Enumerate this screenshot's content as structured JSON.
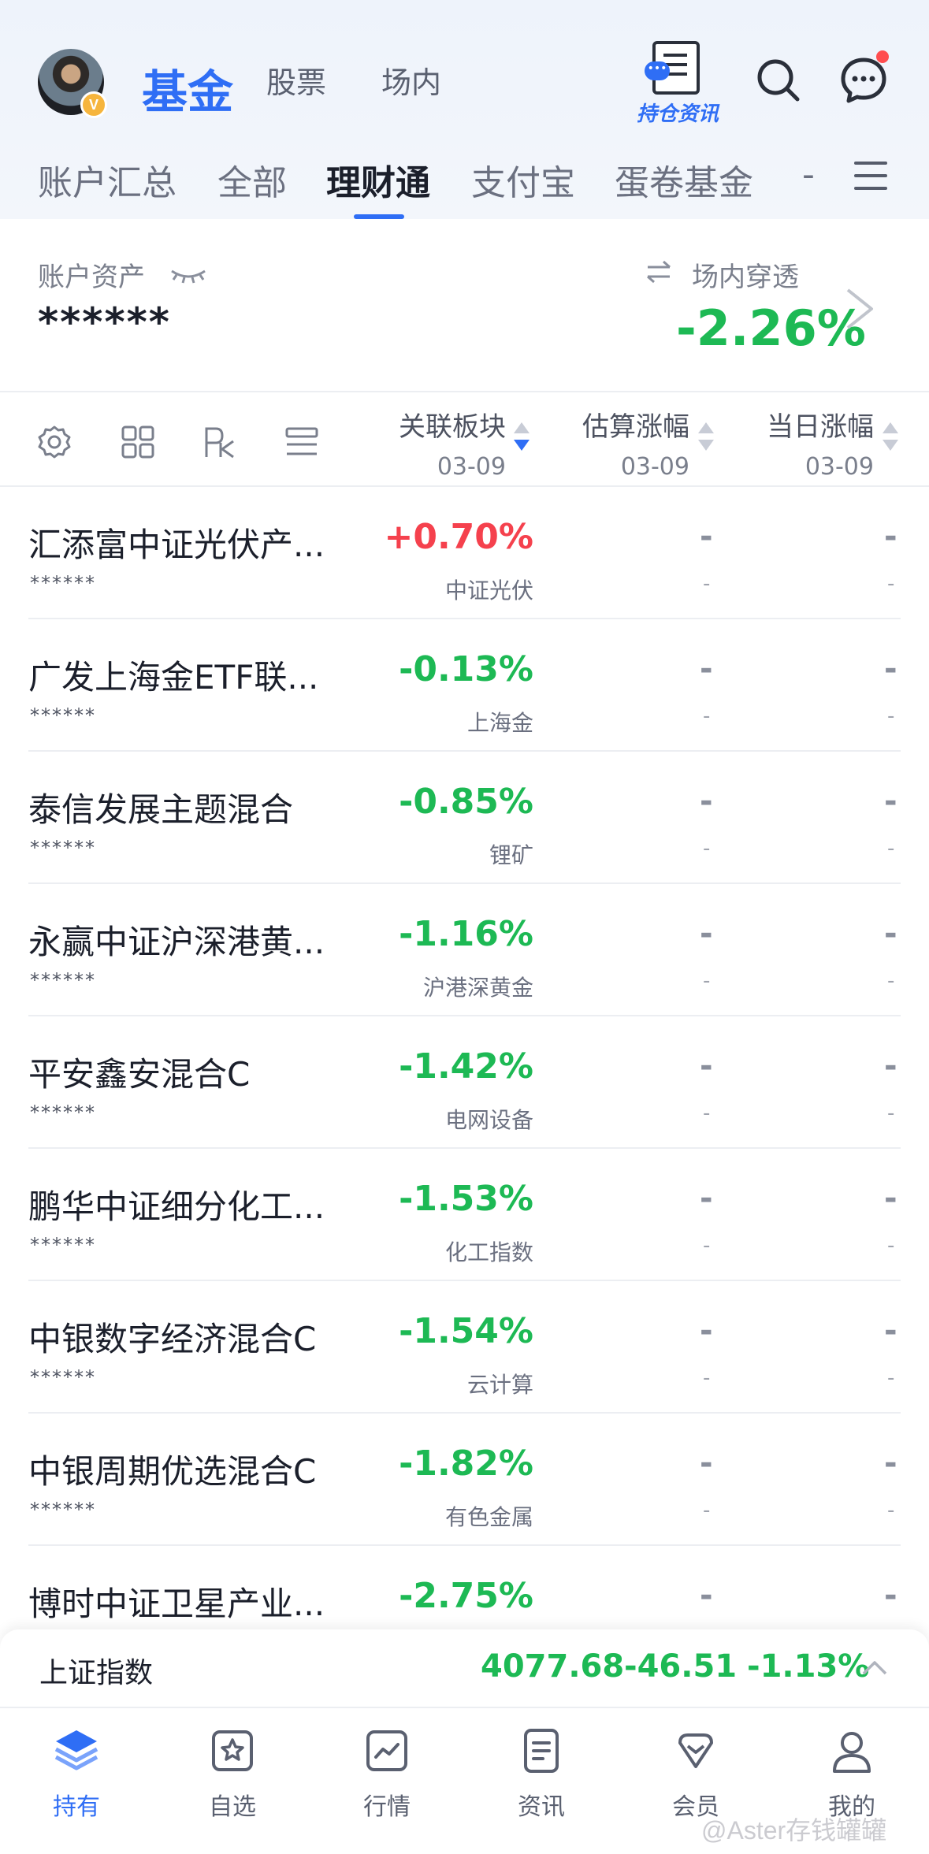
{
  "header": {
    "avatar_badge": "V",
    "tabs": [
      "基金",
      "股票",
      "场内"
    ],
    "active_tab": "基金",
    "news_label": "持仓资讯",
    "accent_color": "#2f6ef5"
  },
  "sub_tabs": {
    "items": [
      "账户汇总",
      "全部",
      "理财通",
      "支付宝",
      "蛋卷基金",
      "-"
    ],
    "active": "理财通"
  },
  "summary": {
    "asset_label": "账户资产",
    "asset_value": "******",
    "penetration_label": "场内穿透",
    "penetration_value": "-2.26%"
  },
  "columns": {
    "sector": {
      "title": "关联板块",
      "date": "03-09"
    },
    "estimate": {
      "title": "估算涨幅",
      "date": "03-09"
    },
    "daily": {
      "title": "当日涨幅",
      "date": "03-09"
    }
  },
  "funds": [
    {
      "name": "汇添富中证光伏产...",
      "mask": "******",
      "change": "+0.70%",
      "direction": "up",
      "sector": "中证光伏"
    },
    {
      "name": "广发上海金ETF联...",
      "mask": "******",
      "change": "-0.13%",
      "direction": "down",
      "sector": "上海金"
    },
    {
      "name": "泰信发展主题混合",
      "mask": "******",
      "change": "-0.85%",
      "direction": "down",
      "sector": "锂矿"
    },
    {
      "name": "永赢中证沪深港黄...",
      "mask": "******",
      "change": "-1.16%",
      "direction": "down",
      "sector": "沪港深黄金"
    },
    {
      "name": "平安鑫安混合C",
      "mask": "******",
      "change": "-1.42%",
      "direction": "down",
      "sector": "电网设备"
    },
    {
      "name": "鹏华中证细分化工...",
      "mask": "******",
      "change": "-1.53%",
      "direction": "down",
      "sector": "化工指数"
    },
    {
      "name": "中银数字经济混合C",
      "mask": "******",
      "change": "-1.54%",
      "direction": "down",
      "sector": "云计算"
    },
    {
      "name": "中银周期优选混合C",
      "mask": "******",
      "change": "-1.82%",
      "direction": "down",
      "sector": "有色金属"
    },
    {
      "name": "博时中证卫星产业...",
      "mask": "",
      "change": "-2.75%",
      "direction": "down",
      "sector": ""
    }
  ],
  "dash_text": "-",
  "index_bar": {
    "name": "上证指数",
    "value": "4077.68",
    "change": "-46.51",
    "percent": "-1.13%"
  },
  "bottom_nav": [
    "持有",
    "自选",
    "行情",
    "资讯",
    "会员",
    "我的"
  ],
  "bottom_nav_active": "持有",
  "watermark": "@Aster存钱罐罐",
  "colors": {
    "up": "#f5414d",
    "down": "#1db954",
    "accent": "#2f6ef5"
  }
}
